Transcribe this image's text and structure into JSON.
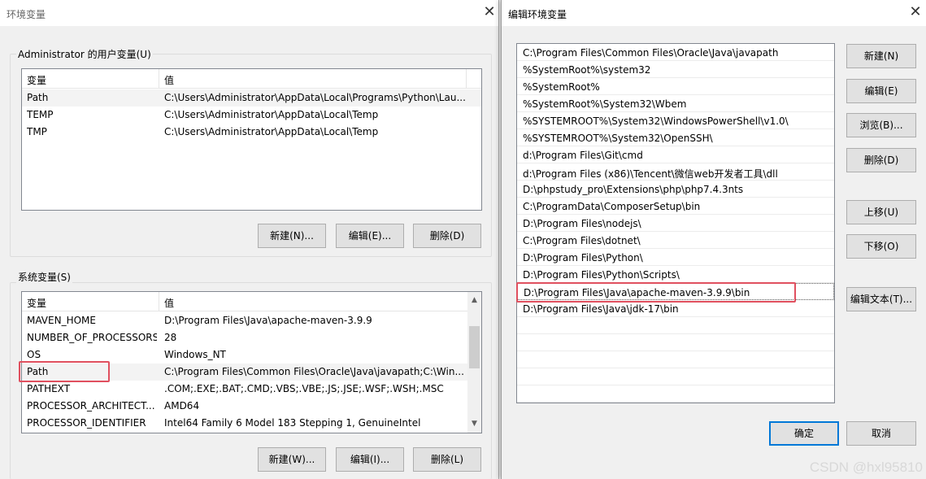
{
  "env_window": {
    "title": "环境变量",
    "user_group": {
      "label": "Administrator 的用户变量(U)",
      "col_var": "变量",
      "col_val": "值",
      "rows": [
        {
          "name": "Path",
          "value": "C:\\Users\\Administrator\\AppData\\Local\\Programs\\Python\\Lau..."
        },
        {
          "name": "TEMP",
          "value": "C:\\Users\\Administrator\\AppData\\Local\\Temp"
        },
        {
          "name": "TMP",
          "value": "C:\\Users\\Administrator\\AppData\\Local\\Temp"
        }
      ],
      "buttons": {
        "new": "新建(N)...",
        "edit": "编辑(E)...",
        "delete": "删除(D)"
      }
    },
    "system_group": {
      "label": "系统变量(S)",
      "col_var": "变量",
      "col_val": "值",
      "rows": [
        {
          "name": "MAVEN_HOME",
          "value": "D:\\Program Files\\Java\\apache-maven-3.9.9"
        },
        {
          "name": "NUMBER_OF_PROCESSORS",
          "value": "28"
        },
        {
          "name": "OS",
          "value": "Windows_NT"
        },
        {
          "name": "Path",
          "value": "C:\\Program Files\\Common Files\\Oracle\\Java\\javapath;C:\\Win..."
        },
        {
          "name": "PATHEXT",
          "value": ".COM;.EXE;.BAT;.CMD;.VBS;.VBE;.JS;.JSE;.WSF;.WSH;.MSC"
        },
        {
          "name": "PROCESSOR_ARCHITECT...",
          "value": "AMD64"
        },
        {
          "name": "PROCESSOR_IDENTIFIER",
          "value": "Intel64 Family 6 Model 183 Stepping 1, GenuineIntel"
        }
      ],
      "buttons": {
        "new": "新建(W)...",
        "edit": "编辑(I)...",
        "delete": "删除(L)"
      }
    }
  },
  "edit_window": {
    "title": "编辑环境变量",
    "paths": [
      "C:\\Program Files\\Common Files\\Oracle\\Java\\javapath",
      "%SystemRoot%\\system32",
      "%SystemRoot%",
      "%SystemRoot%\\System32\\Wbem",
      "%SYSTEMROOT%\\System32\\WindowsPowerShell\\v1.0\\",
      "%SYSTEMROOT%\\System32\\OpenSSH\\",
      "d:\\Program Files\\Git\\cmd",
      "d:\\Program Files (x86)\\Tencent\\微信web开发者工具\\dll",
      "D:\\phpstudy_pro\\Extensions\\php\\php7.4.3nts",
      "C:\\ProgramData\\ComposerSetup\\bin",
      "D:\\Program Files\\nodejs\\",
      "C:\\Program Files\\dotnet\\",
      "D:\\Program Files\\Python\\",
      "D:\\Program Files\\Python\\Scripts\\",
      "D:\\Program Files\\Java\\apache-maven-3.9.9\\bin",
      "D:\\Program Files\\Java\\jdk-17\\bin"
    ],
    "buttons": {
      "new": "新建(N)",
      "edit": "编辑(E)",
      "browse": "浏览(B)...",
      "delete": "删除(D)",
      "move_up": "上移(U)",
      "move_down": "下移(O)",
      "edit_text": "编辑文本(T)...",
      "ok": "确定",
      "cancel": "取消"
    }
  },
  "watermark": "CSDN @hxl95810",
  "colors": {
    "highlight": "#e0505f",
    "accent": "#0078d7"
  }
}
